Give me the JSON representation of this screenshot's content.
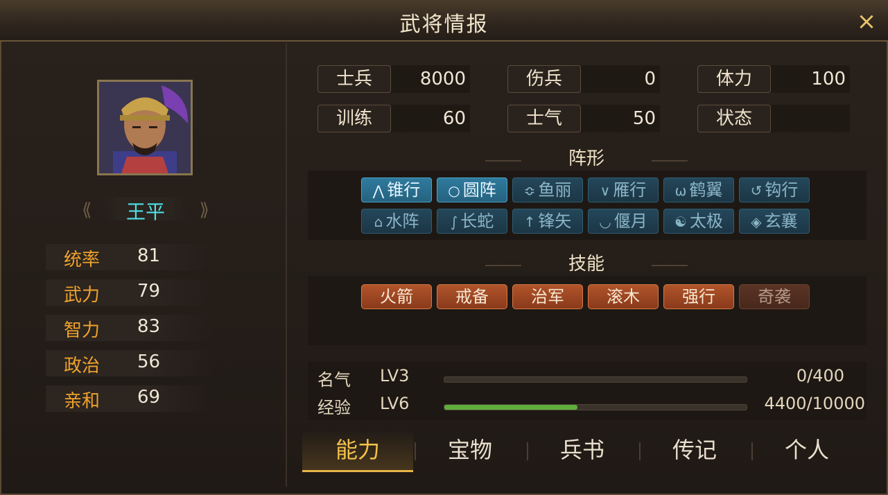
{
  "window": {
    "title": "武将情报",
    "close_icon": "×"
  },
  "general": {
    "name": "王平",
    "left_arrow": "⟪",
    "right_arrow": "⟫"
  },
  "attributes": [
    {
      "label": "统率",
      "value": "81"
    },
    {
      "label": "武力",
      "value": "79"
    },
    {
      "label": "智力",
      "value": "83"
    },
    {
      "label": "政治",
      "value": "56"
    },
    {
      "label": "亲和",
      "value": "69"
    }
  ],
  "troops": [
    {
      "label": "士兵",
      "value": "8000"
    },
    {
      "label": "伤兵",
      "value": "0"
    },
    {
      "label": "体力",
      "value": "100"
    },
    {
      "label": "训练",
      "value": "60"
    },
    {
      "label": "士气",
      "value": "50"
    },
    {
      "label": "状态",
      "value": ""
    }
  ],
  "formation": {
    "title": "阵形",
    "items": [
      {
        "label": "锥行",
        "icon": "⋀"
      },
      {
        "label": "圆阵",
        "icon": "○"
      },
      {
        "label": "鱼丽",
        "icon": "≎"
      },
      {
        "label": "雁行",
        "icon": "∨"
      },
      {
        "label": "鹤翼",
        "icon": "ω"
      },
      {
        "label": "钩行",
        "icon": "↺"
      },
      {
        "label": "水阵",
        "icon": "⌂"
      },
      {
        "label": "长蛇",
        "icon": "∫"
      },
      {
        "label": "锋矢",
        "icon": "↑"
      },
      {
        "label": "偃月",
        "icon": "◡"
      },
      {
        "label": "太极",
        "icon": "☯"
      },
      {
        "label": "玄襄",
        "icon": "◈"
      }
    ]
  },
  "skills": {
    "title": "技能",
    "items": [
      "火箭",
      "戒备",
      "治军",
      "滚木",
      "强行",
      "奇袭"
    ]
  },
  "fame": {
    "label": "名气",
    "level": "LV3",
    "progress": "0/400",
    "fraction": 0
  },
  "experience": {
    "label": "经验",
    "level": "LV6",
    "progress": "4400/10000",
    "fraction": 0.44
  },
  "tabs": [
    "能力",
    "宝物",
    "兵书",
    "传记",
    "个人"
  ],
  "colors": {
    "accent": "#f0a22c",
    "name": "#4fe0e8",
    "tab_active": "#f4c24a",
    "exp_bar": "#5fae3c"
  }
}
